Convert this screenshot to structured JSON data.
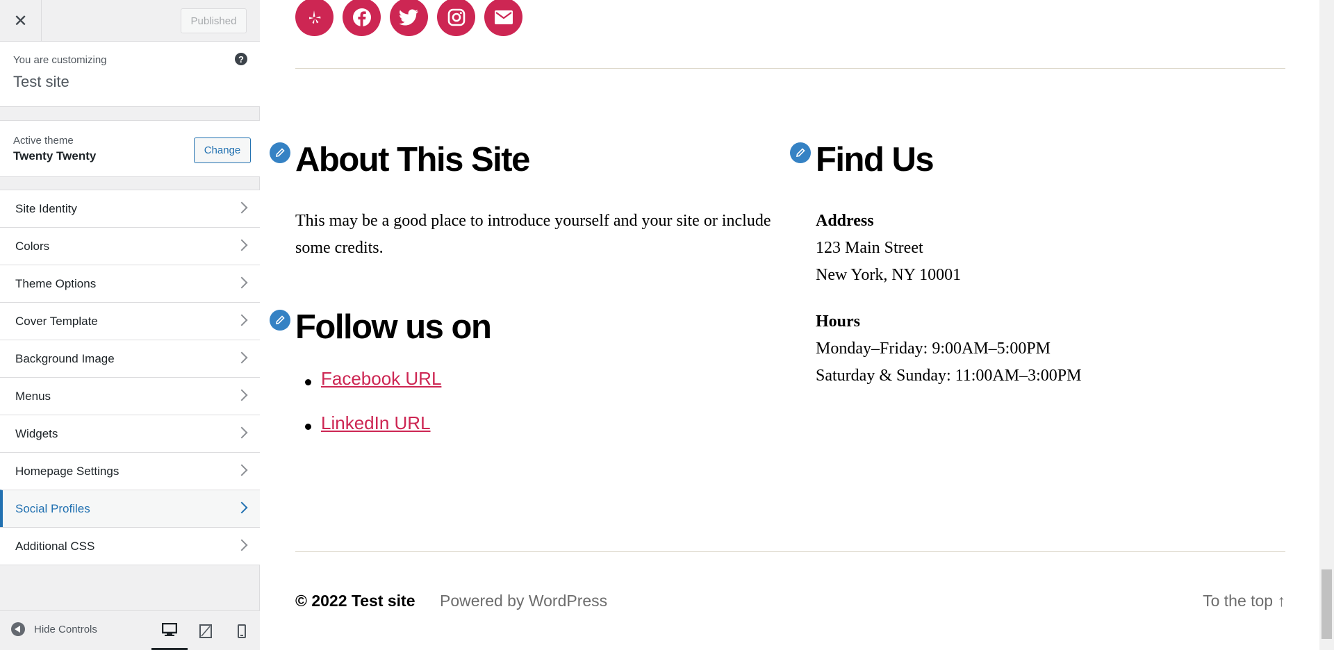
{
  "sidebar": {
    "publish_label": "Published",
    "customizing_label": "You are customizing",
    "site_name": "Test site",
    "active_theme_label": "Active theme",
    "theme_name": "Twenty Twenty",
    "change_label": "Change",
    "menu": [
      {
        "label": "Site Identity"
      },
      {
        "label": "Colors"
      },
      {
        "label": "Theme Options"
      },
      {
        "label": "Cover Template"
      },
      {
        "label": "Background Image"
      },
      {
        "label": "Menus"
      },
      {
        "label": "Widgets"
      },
      {
        "label": "Homepage Settings"
      },
      {
        "label": "Social Profiles",
        "active": true
      },
      {
        "label": "Additional CSS"
      }
    ],
    "hide_controls_label": "Hide Controls",
    "devices": [
      "desktop-icon",
      "tablet-icon",
      "mobile-icon"
    ]
  },
  "preview": {
    "social_icons": [
      "yelp-icon",
      "facebook-icon",
      "twitter-icon",
      "instagram-icon",
      "email-icon"
    ],
    "about": {
      "title": "About This Site",
      "text": "This may be a good place to introduce yourself and your site or include some credits."
    },
    "follow": {
      "title": "Follow us on",
      "links": [
        "Facebook URL",
        "LinkedIn URL"
      ]
    },
    "find_us": {
      "title": "Find Us",
      "address_label": "Address",
      "address_line1": "123 Main Street",
      "address_line2": "New York, NY 10001",
      "hours_label": "Hours",
      "hours_line1": "Monday–Friday: 9:00AM–5:00PM",
      "hours_line2": "Saturday & Sunday: 11:00AM–3:00PM"
    },
    "footer": {
      "copyright": "© 2022 Test site",
      "powered": "Powered by WordPress",
      "to_top": "To the top ↑"
    }
  },
  "colors": {
    "accent": "#cd2653",
    "wp_blue": "#2271b1",
    "pencil_blue": "#3582c4"
  }
}
